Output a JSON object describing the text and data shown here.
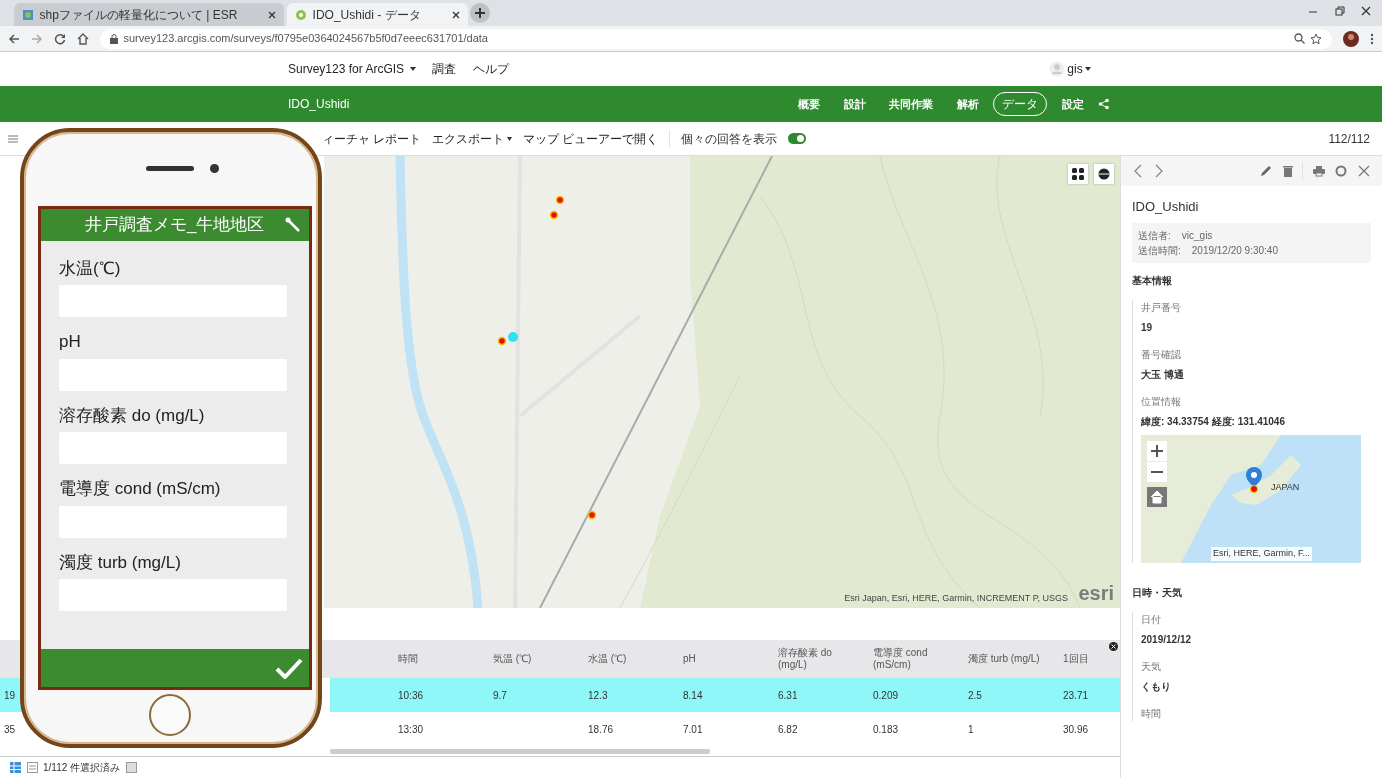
{
  "browser": {
    "tabs": [
      {
        "title": "shpファイルの軽量化について | ESR",
        "selected": false
      },
      {
        "title": "IDO_Ushidi - データ",
        "selected": true
      }
    ],
    "url": "survey123.arcgis.com/surveys/f0795e0364024567b5f0d7eeec631701/data"
  },
  "app_header": {
    "brand": "Survey123 for ArcGIS",
    "links": [
      "調査",
      "ヘルプ"
    ],
    "user": "gis"
  },
  "survey_bar": {
    "title": "IDO_Ushidi",
    "tabs": [
      {
        "label": "概要",
        "selected": false
      },
      {
        "label": "設計",
        "selected": false
      },
      {
        "label": "共同作業",
        "selected": false
      },
      {
        "label": "解析",
        "selected": false
      },
      {
        "label": "データ",
        "selected": true
      },
      {
        "label": "設定",
        "selected": false
      }
    ]
  },
  "toolbar": {
    "items": [
      {
        "label": "ィーチャ レポート",
        "dropdown": false
      },
      {
        "label": "エクスポート",
        "dropdown": true
      },
      {
        "label": "マップ ビューアーで開く",
        "dropdown": false
      }
    ],
    "toggle": {
      "label": "個々の回答を表示",
      "on": true
    },
    "count": "112/112"
  },
  "map": {
    "attribution": "Esri Japan, Esri, HERE, Garmin, INCREMENT P, USGS",
    "logo": "esri"
  },
  "table": {
    "columns": [
      "時間",
      "気温 (℃)",
      "水温 (℃)",
      "pH",
      "溶存酸素 do (mg/L)",
      "電導度 cond (mS/cm)",
      "濁度 turb (mg/L)",
      "1回目"
    ],
    "rows": [
      {
        "selected": true,
        "column_1": "19",
        "cells": [
          "10:36",
          "9.7",
          "12.3",
          "8.14",
          "6.31",
          "0.209",
          "2.5",
          "23.71"
        ]
      },
      {
        "selected": false,
        "column_1": "35",
        "cells": [
          "13:30",
          null,
          "18.76",
          "7.01",
          "6.82",
          "0.183",
          "1",
          "30.96"
        ]
      }
    ]
  },
  "status_bar": {
    "text": "1/112 件選択済み"
  },
  "detail_panel": {
    "title": "IDO_Ushidi",
    "meta": [
      {
        "label": "送信者:",
        "value": "vic_gis"
      },
      {
        "label": "送信時間:",
        "value": "2019/12/20 9:30:40"
      }
    ],
    "sections": [
      {
        "heading": "基本情報",
        "fields": [
          {
            "kind": "text",
            "label": "井戸番号",
            "value": "19"
          },
          {
            "kind": "text",
            "label": "番号確認",
            "value": "大玉 博通"
          },
          {
            "kind": "map",
            "label": "位置情報",
            "value": "緯度: 34.33754 経度: 131.41046",
            "map_label": "JAPAN",
            "map_attribution": "Esri, HERE, Garmin, F..."
          }
        ]
      },
      {
        "heading": "日時・天気",
        "fields": [
          {
            "kind": "text",
            "label": "日付",
            "value": "2019/12/12"
          },
          {
            "kind": "text",
            "label": "天気",
            "value": "くもり"
          },
          {
            "kind": "text",
            "label": "時間"
          }
        ]
      }
    ]
  },
  "phone": {
    "title": "井戸調査メモ_牛地地区",
    "fields": [
      "水温(℃)",
      "pH",
      "溶存酸素 do (mg/L)",
      "電導度 cond (mS/cm)",
      "濁度 turb (mg/L)"
    ]
  }
}
